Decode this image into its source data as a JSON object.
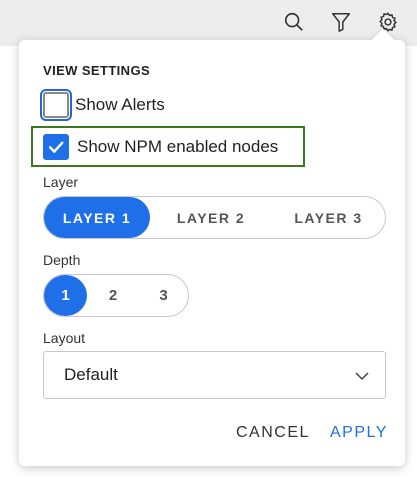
{
  "toolbar": {
    "icons": [
      "search-icon",
      "filter-icon",
      "gear-icon"
    ]
  },
  "panel": {
    "title": "VIEW SETTINGS",
    "show_alerts": {
      "label": "Show Alerts",
      "checked": false
    },
    "show_npm": {
      "label": "Show NPM enabled nodes",
      "checked": true
    },
    "layer": {
      "label": "Layer",
      "options": [
        "LAYER 1",
        "LAYER 2",
        "LAYER 3"
      ],
      "selected": "LAYER 1"
    },
    "depth": {
      "label": "Depth",
      "options": [
        "1",
        "2",
        "3"
      ],
      "selected": "1"
    },
    "layout": {
      "label": "Layout",
      "value": "Default"
    },
    "cancel_label": "CANCEL",
    "apply_label": "APPLY"
  },
  "colors": {
    "accent": "#1f6fe8",
    "highlight_border": "#3a7a1c"
  }
}
